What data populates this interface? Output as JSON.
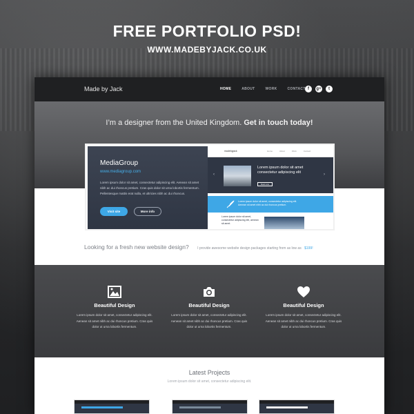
{
  "promo": {
    "title": "FREE PORTFOLIO PSD!",
    "url": "WWW.MADEBYJACK.CO.UK"
  },
  "nav": {
    "brand": "Made by Jack",
    "links": [
      {
        "label": "HOME",
        "active": true
      },
      {
        "label": "ABOUT",
        "active": false
      },
      {
        "label": "WORK",
        "active": false
      },
      {
        "label": "CONTACT",
        "active": false
      }
    ],
    "social": [
      {
        "icon": "facebook-icon",
        "glyph": "f"
      },
      {
        "icon": "google-plus-icon",
        "glyph": "g+"
      },
      {
        "icon": "twitter-icon",
        "glyph": "t"
      }
    ]
  },
  "hero": {
    "intro": "I’m a designer from the United Kingdom.",
    "cta": "Get in touch today!"
  },
  "featured": {
    "title": "MediaGroup",
    "link": "www.mediagroup.com",
    "description": "Lorem ipsum dolor sit amet, consectetur adipiscing elit. Aenean sit amet nibh ac dui rhoncus pretium. Cras quis dolor sit urna lobortis fermentum. Pellentesque mattis erat nulla, et ultricies nibh ac dui rhoncus.",
    "primary_button": "Visit site",
    "secondary_button": "More info",
    "mini": {
      "brand": "madebyjack",
      "links": [
        "Home",
        "About",
        "Work",
        "Contact"
      ],
      "hero_heading": "Lorem ipsum dolor sit amet consectetur adipiscing elit",
      "hero_button": "Read more",
      "arrow_left": "‹",
      "arrow_right": "›",
      "blue_text": "Lorem ipsum dolor sit amet, consectetur adipiscing elit. Aenean sit amet nibh ac dui rhoncus pretium.",
      "bottom_text": "Lorem ipsum dolor sit amet, consectetur adipiscing elit, aenean sit amet."
    }
  },
  "lead": {
    "question": "Looking for a fresh new website design?",
    "offer": "I provide awesome website design packages starting from as low as",
    "price": "$199!"
  },
  "features": [
    {
      "icon": "image-icon",
      "title": "Beautiful Design",
      "text": "Lorem ipsum dolor sit amet, consectetur adipiscing elit. Aenean sit amet nibh ac dui rhoncus pretium. Cras quis dolor ut urna lobortis fermentum."
    },
    {
      "icon": "camera-icon",
      "title": "Beautiful Design",
      "text": "Lorem ipsum dolor sit amet, consectetur adipiscing elit. Aenean sit amet nibh ac dui rhoncus pretium. Cras quis dolor ut urna lobortis fermentum."
    },
    {
      "icon": "heart-icon",
      "title": "Beautiful Design",
      "text": "Lorem ipsum dolor sit amet, consectetur adipiscing elit. Aenean sit amet nibh ac dui rhoncus pretium. Cras quis dolor ut urna lobortis fermentum."
    }
  ],
  "projects": {
    "title": "Latest Projects",
    "subtitle": "Lorem ipsum dolor sit amet, consectetur adipiscing elit."
  },
  "colors": {
    "accent": "#3ea7e6",
    "nav_bg": "#1f2022",
    "card_bg": "#2f3644"
  }
}
